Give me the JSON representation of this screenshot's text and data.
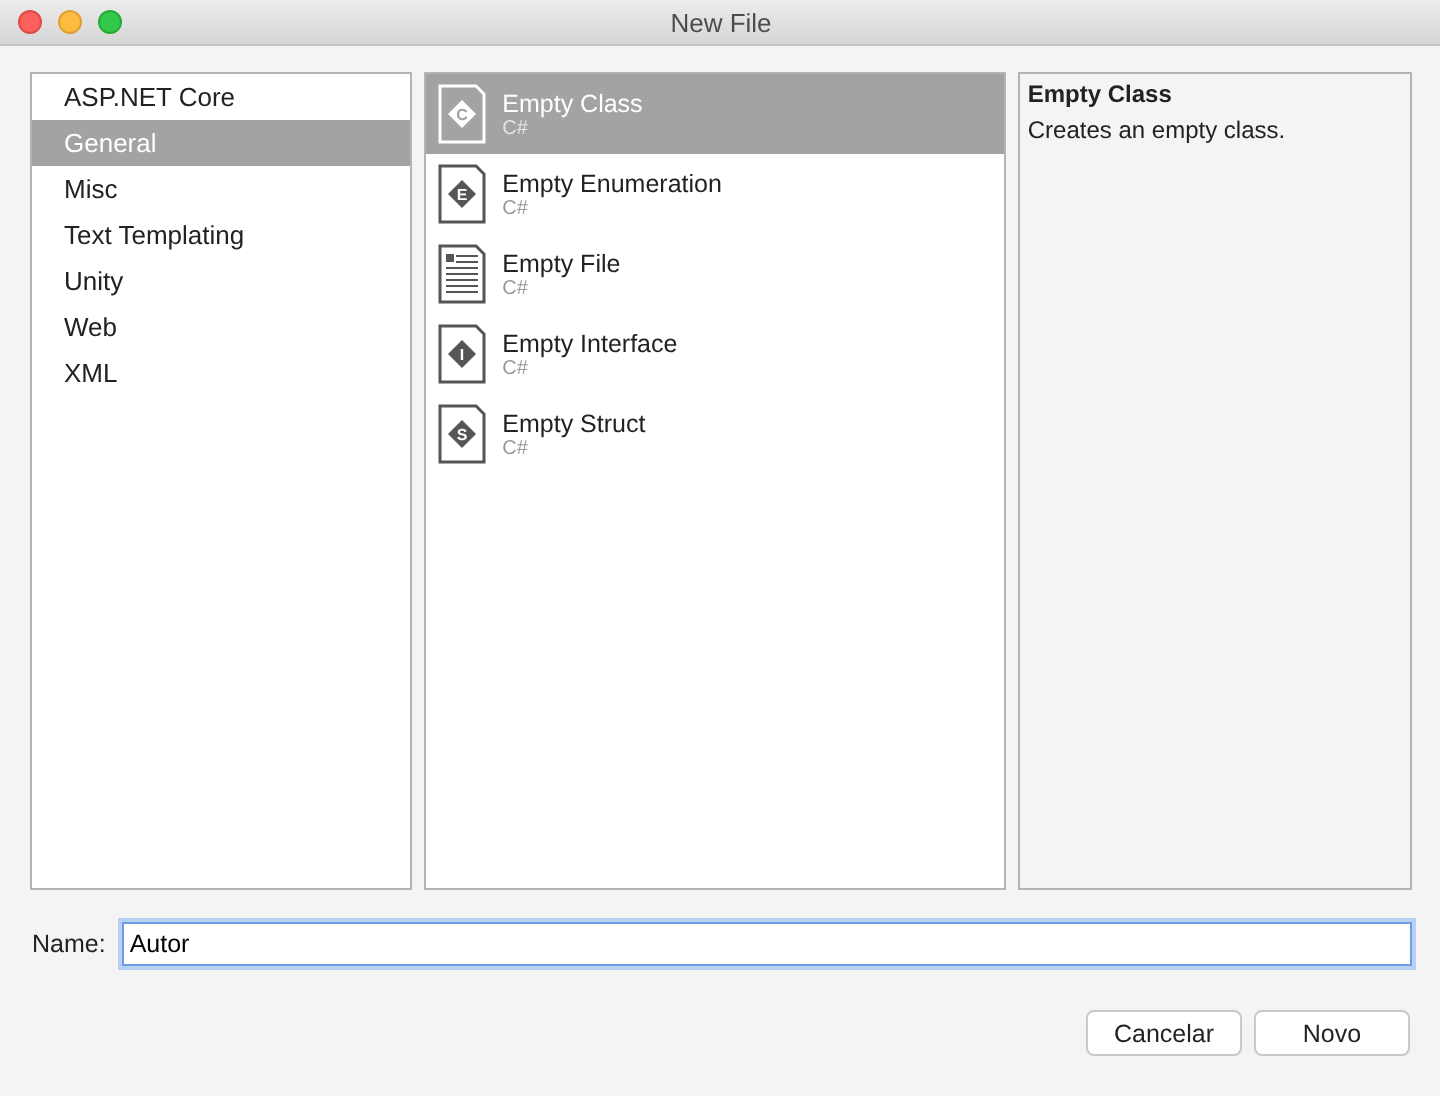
{
  "window": {
    "title": "New File"
  },
  "categories": [
    {
      "label": "ASP.NET Core",
      "selected": false
    },
    {
      "label": "General",
      "selected": true
    },
    {
      "label": "Misc",
      "selected": false
    },
    {
      "label": "Text Templating",
      "selected": false
    },
    {
      "label": "Unity",
      "selected": false
    },
    {
      "label": "Web",
      "selected": false
    },
    {
      "label": "XML",
      "selected": false
    }
  ],
  "templates": [
    {
      "name": "Empty Class",
      "language": "C#",
      "kind": "code",
      "badge": "C",
      "selected": true
    },
    {
      "name": "Empty Enumeration",
      "language": "C#",
      "kind": "code",
      "badge": "E",
      "selected": false
    },
    {
      "name": "Empty File",
      "language": "C#",
      "kind": "document",
      "selected": false
    },
    {
      "name": "Empty Interface",
      "language": "C#",
      "kind": "code",
      "badge": "I",
      "selected": false
    },
    {
      "name": "Empty Struct",
      "language": "C#",
      "kind": "code",
      "badge": "S",
      "selected": false
    }
  ],
  "description": {
    "title": "Empty Class",
    "text": "Creates an empty class."
  },
  "name_field": {
    "label": "Name:",
    "value": "Autor"
  },
  "buttons": [
    "Cancelar",
    "Novo"
  ]
}
